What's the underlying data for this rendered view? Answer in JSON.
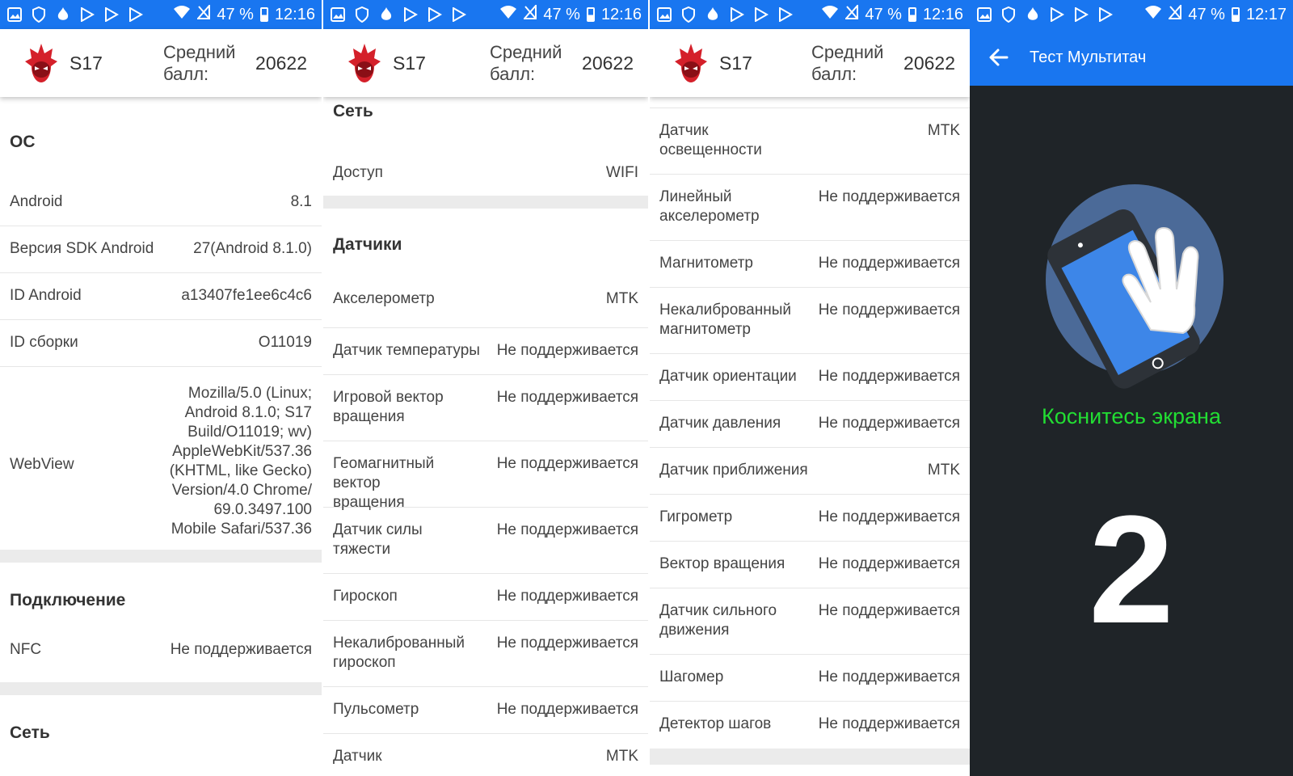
{
  "status": {
    "battery": "47 %",
    "time_a": "12:16",
    "time_b": "12:17"
  },
  "header": {
    "device": "S17",
    "avg_label": "Средний балл:",
    "score": "20622"
  },
  "panel1": {
    "os_title": "ОС",
    "os_rows": [
      {
        "label": "Android",
        "value": "8.1"
      },
      {
        "label": "Версия SDK Android",
        "value": "27(Android 8.1.0)"
      },
      {
        "label": "ID Android",
        "value": "a13407fe1ee6c4c6"
      },
      {
        "label": "ID сборки",
        "value": "O11019"
      },
      {
        "label": "WebView",
        "value": "Mozilla/5.0 (Linux; Android 8.1.0; S17 Build/O11019; wv) AppleWebKit/537.36 (KHTML, like Gecko) Version/4.0 Chrome/ 69.0.3497.100 Mobile Safari/537.36"
      }
    ],
    "conn_title": "Подключение",
    "conn_rows": [
      {
        "label": "NFC",
        "value": "Не поддерживается"
      }
    ],
    "net_title": "Сеть"
  },
  "panel2": {
    "net_title": "Сеть",
    "net_rows": [
      {
        "label": "Доступ",
        "value": "WIFI"
      }
    ],
    "sensors_title": "Датчики",
    "sensor_rows": [
      {
        "label": "Акселерометр",
        "value": "MTK"
      },
      {
        "label": "Датчик температуры",
        "value": "Не поддерживается"
      },
      {
        "label": "Игровой вектор вращения",
        "value": "Не поддерживается"
      },
      {
        "label": "Геомагнитный вектор вращения",
        "value": "Не поддерживается"
      },
      {
        "label": "Датчик силы тяжести",
        "value": "Не поддерживается"
      },
      {
        "label": "Гироскоп",
        "value": "Не поддерживается"
      },
      {
        "label": "Некалиброванный гироскоп",
        "value": "Не поддерживается"
      },
      {
        "label": "Пульсометр",
        "value": "Не поддерживается"
      },
      {
        "label": "Датчик",
        "value": "MTK"
      }
    ]
  },
  "panel3": {
    "sensor_rows": [
      {
        "label": "Датчик освещенности",
        "value": "MTK"
      },
      {
        "label": "Линейный акселерометр",
        "value": "Не поддерживается"
      },
      {
        "label": "Магнитометр",
        "value": "Не поддерживается"
      },
      {
        "label": "Некалиброванный магнитометр",
        "value": "Не поддерживается"
      },
      {
        "label": "Датчик ориентации",
        "value": "Не поддерживается"
      },
      {
        "label": "Датчик давления",
        "value": "Не поддерживается"
      },
      {
        "label": "Датчик приближения",
        "value": "MTK"
      },
      {
        "label": "Гигрометр",
        "value": "Не поддерживается"
      },
      {
        "label": "Вектор вращения",
        "value": "Не поддерживается"
      },
      {
        "label": "Датчик сильного движения",
        "value": "Не поддерживается"
      },
      {
        "label": "Шагомер",
        "value": "Не поддерживается"
      },
      {
        "label": "Детектор шагов",
        "value": "Не поддерживается"
      }
    ]
  },
  "multitouch": {
    "title": "Тест Мультитач",
    "hint": "Коснитесь экрана",
    "count": "2"
  },
  "colors": {
    "statusbar": "#1976f0",
    "hint": "#22dd33",
    "dark_bg": "#1f2428",
    "logo_red": "#d4202a"
  }
}
